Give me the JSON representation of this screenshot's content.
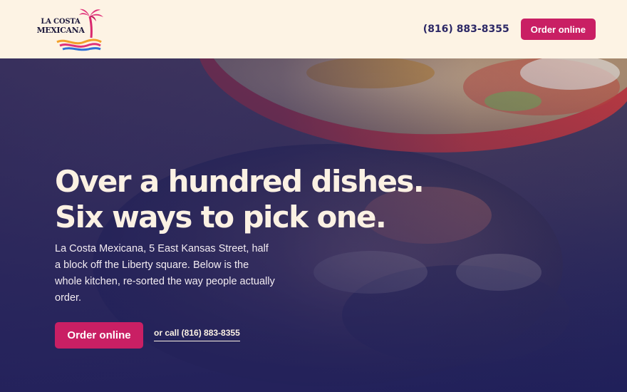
{
  "brand": {
    "line1": "LA COSTA",
    "line2": "MEXICANA",
    "logo_icon": "palm-tree-sunset-logo",
    "colors": {
      "pink": "#e0327a",
      "orange": "#f2a02a",
      "blue": "#2f6fd6"
    }
  },
  "header": {
    "phone": "(816) 883-8355",
    "order_label": "Order online"
  },
  "hero": {
    "headline_line1": "Over a hundred dishes.",
    "headline_line2": "Six ways to pick one.",
    "intro": "La Costa Mexicana, 5 East Kansas Street, half a block off the Liberty square. Below is the whole kitchen, re-sorted the way people actually order.",
    "order_label": "Order online",
    "call_label": "or call (816) 883-8355",
    "background": "photo of fajita skillet and plate of rice and beans"
  },
  "colors": {
    "header_bg": "#fdf3e4",
    "accent": "#c91f64",
    "navy": "#2c2866",
    "cream_text": "#fbf1e3"
  }
}
